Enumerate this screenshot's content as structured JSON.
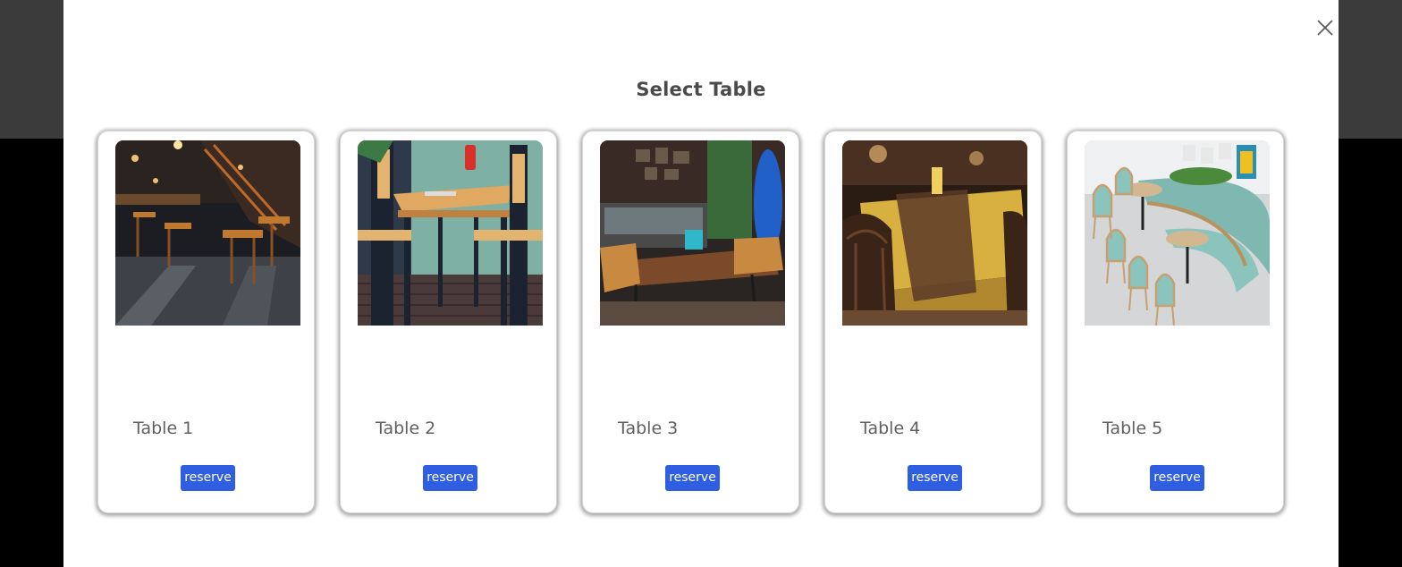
{
  "modal": {
    "title": "Select Table",
    "close_icon": "close-icon"
  },
  "tables": [
    {
      "label": "Table 1",
      "button": "reserve",
      "image": "dark-restaurant-interior-photo"
    },
    {
      "label": "Table 2",
      "button": "reserve",
      "image": "wooden-bar-table-photo"
    },
    {
      "label": "Table 3",
      "button": "reserve",
      "image": "cafe-table-with-chairs-photo"
    },
    {
      "label": "Table 4",
      "button": "reserve",
      "image": "yellow-tablecloth-table-photo"
    },
    {
      "label": "Table 5",
      "button": "reserve",
      "image": "booth-seating-photo"
    }
  ],
  "colors": {
    "accent": "#2f5ee0",
    "backdrop": "#3b3b3b",
    "title_text": "#4a4a4a",
    "label_text": "#5f5f5f"
  }
}
